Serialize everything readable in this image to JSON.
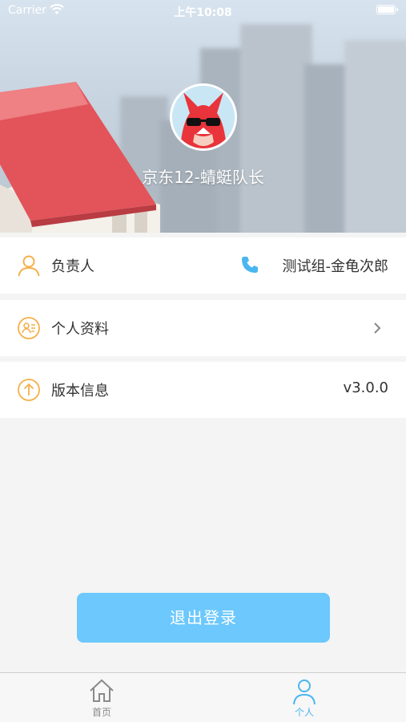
{
  "status_bar": {
    "carrier": "Carrier",
    "time": "上午10:08"
  },
  "profile": {
    "username": "京东12-蜻蜓队长"
  },
  "rows": [
    {
      "label": "负责人",
      "value": "测试组-金龟次郎",
      "icon": "person-icon"
    },
    {
      "label": "个人资料",
      "value": "",
      "icon": "profile-card-icon"
    },
    {
      "label": "版本信息",
      "value": "v3.0.0",
      "icon": "upload-arrow-icon"
    }
  ],
  "logout_label": "退出登录",
  "tabs": [
    {
      "label": "首页",
      "icon": "home-icon",
      "active": false
    },
    {
      "label": "个人",
      "icon": "user-icon",
      "active": true
    }
  ],
  "colors": {
    "accent": "#6cc8fd",
    "icon_orange": "#f5b04a",
    "tab_active": "#4ab6f0",
    "tab_inactive": "#8a8a8a"
  }
}
